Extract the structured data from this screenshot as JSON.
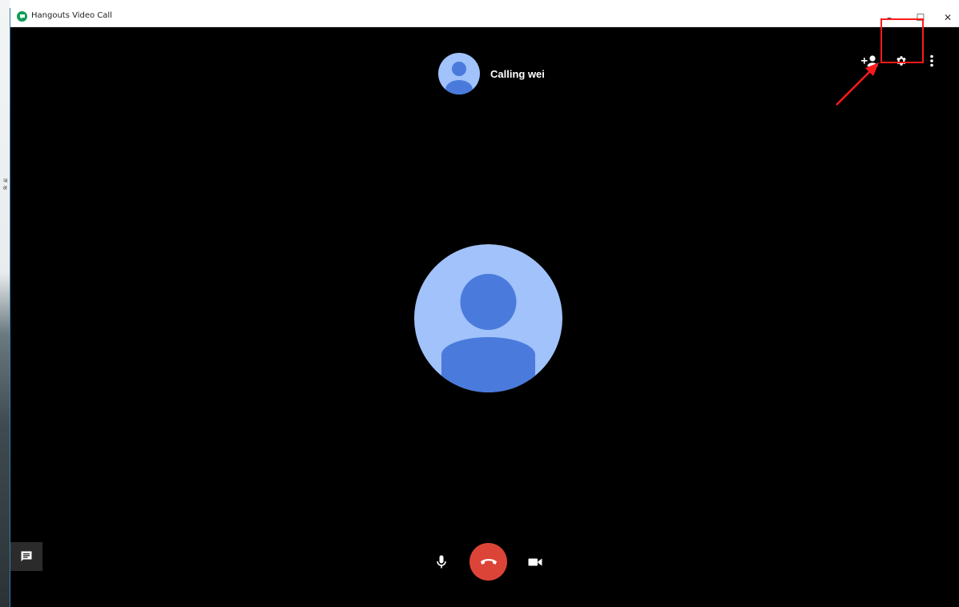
{
  "window": {
    "title": "Hangouts Video Call",
    "controls": {
      "minimize": "–",
      "maximize": "☐",
      "close": "✕"
    }
  },
  "call": {
    "status_text": "Calling wei"
  },
  "colors": {
    "hangup_red": "#db4437",
    "avatar_light": "#a1c2fa",
    "avatar_dark": "#4a7bdc",
    "highlight_red": "#ff1a1a"
  },
  "icons": {
    "app": "hangouts-icon",
    "add_person": "add-person-icon",
    "settings": "gear-icon",
    "more": "more-vert-icon",
    "chat": "chat-icon",
    "mic": "microphone-icon",
    "hangup": "call-end-icon",
    "camera": "videocam-icon"
  }
}
